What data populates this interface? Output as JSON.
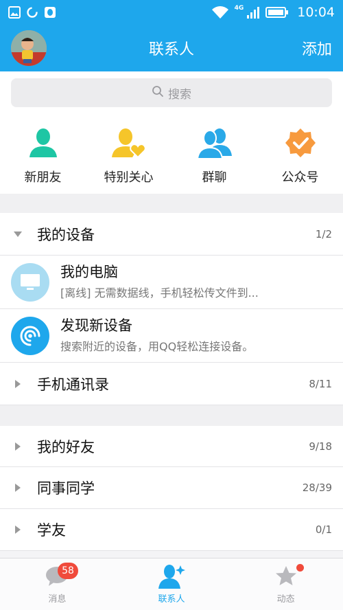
{
  "status_bar": {
    "network": "4G",
    "time": "10:04",
    "icons": [
      "image-notification-icon",
      "sync-icon",
      "qq-notification-icon",
      "wifi-icon",
      "signal-icon",
      "battery-icon"
    ]
  },
  "header": {
    "title": "联系人",
    "add_label": "添加"
  },
  "search": {
    "placeholder": "搜索"
  },
  "quick_actions": [
    {
      "label": "新朋友",
      "icon": "person-icon",
      "color": "#1ec6a4"
    },
    {
      "label": "特别关心",
      "icon": "person-heart-icon",
      "color": "#f5c52a"
    },
    {
      "label": "群聊",
      "icon": "group-icon",
      "color": "#2aa9e8"
    },
    {
      "label": "公众号",
      "icon": "badge-check-icon",
      "color": "#f79a3e"
    }
  ],
  "groups": {
    "my_devices": {
      "name": "我的设备",
      "count": "1/2",
      "expanded": true
    },
    "phone_contacts": {
      "name": "手机通讯录",
      "count": "8/11"
    },
    "my_friends": {
      "name": "我的好友",
      "count": "9/18"
    },
    "colleagues": {
      "name": "同事同学",
      "count": "28/39"
    },
    "schoolmates": {
      "name": "学友",
      "count": "0/1"
    }
  },
  "devices": [
    {
      "name": "我的电脑",
      "desc": "[离线] 无需数据线，手机轻松传文件到...",
      "icon": "computer-icon",
      "color": "#a9dcf2"
    },
    {
      "name": "发现新设备",
      "desc": "搜索附近的设备，用QQ轻松连接设备。",
      "icon": "radar-icon",
      "color": "#1ea7ec"
    }
  ],
  "tabbar": {
    "messages": {
      "label": "消息",
      "badge": "58"
    },
    "contacts": {
      "label": "联系人",
      "active": true
    },
    "feed": {
      "label": "动态",
      "has_dot": true
    }
  },
  "colors": {
    "primary": "#1ea7ec",
    "badge": "#f04a3b"
  }
}
